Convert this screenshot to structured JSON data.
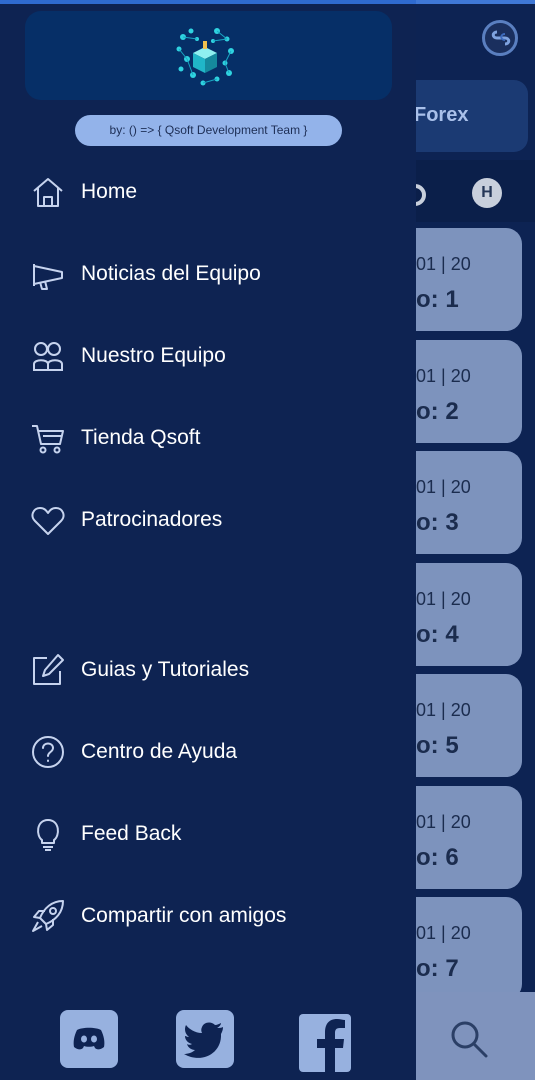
{
  "background": {
    "section_label": "Forex",
    "chip_label": "H",
    "cards": [
      {
        "date": "01 | 20",
        "number": "o: 1"
      },
      {
        "date": "01 | 20",
        "number": "o: 2"
      },
      {
        "date": "01 | 20",
        "number": "o: 3"
      },
      {
        "date": "01 | 20",
        "number": "o: 4"
      },
      {
        "date": "01 | 20",
        "number": "o: 5"
      },
      {
        "date": "01 | 20",
        "number": "o: 6"
      },
      {
        "date": "01 | 20",
        "number": "o: 7"
      }
    ]
  },
  "drawer": {
    "credit": "by: () => { Qsoft Development Team }",
    "menu": [
      {
        "label": "Home",
        "icon": "home-icon"
      },
      {
        "label": "Noticias del Equipo",
        "icon": "megaphone-icon"
      },
      {
        "label": "Nuestro Equipo",
        "icon": "team-icon"
      },
      {
        "label": "Tienda Qsoft",
        "icon": "cart-icon"
      },
      {
        "label": "Patrocinadores",
        "icon": "heart-icon"
      },
      {
        "label": "Guias y Tutoriales",
        "icon": "edit-icon"
      },
      {
        "label": "Centro de Ayuda",
        "icon": "help-icon"
      },
      {
        "label": "Feed Back",
        "icon": "lightbulb-icon"
      },
      {
        "label": "Compartir con amigos",
        "icon": "rocket-icon"
      }
    ],
    "social": [
      "discord-icon",
      "twitter-icon",
      "facebook-icon"
    ]
  },
  "colors": {
    "drawer_bg": "#0e2352",
    "header_bg": "#062f67",
    "credit_bg": "#93b3ea",
    "card_bg": "#7d93bd",
    "social_bg": "#97b1df",
    "accent": "#2f6bd0"
  }
}
